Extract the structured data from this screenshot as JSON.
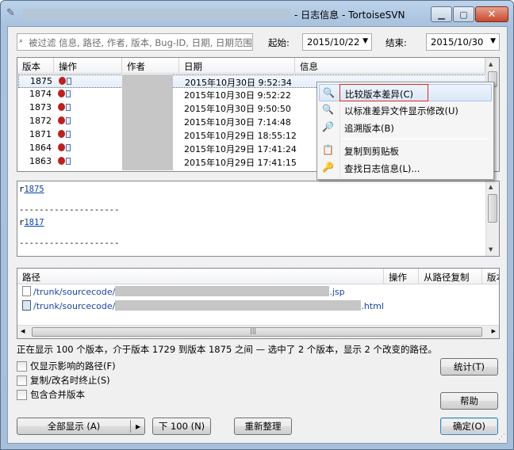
{
  "window": {
    "title": "- 日志信息 - TortoiseSVN",
    "min_icon": "minimize-icon",
    "max_icon": "maximize-icon",
    "close_icon": "close-icon"
  },
  "filter": {
    "placeholder": "被过滤 信息, 路径, 作者, 版本, Bug-ID, 日期, 日期范围"
  },
  "range": {
    "from_label": "起始:",
    "from_value": "2015/10/22",
    "to_label": "结束:",
    "to_value": "2015/10/30"
  },
  "revisions": {
    "columns": [
      "版本",
      "操作",
      "作者",
      "日期",
      "信息"
    ],
    "rows": [
      {
        "rev": "1875",
        "date": "2015年10月30日 9:52:34"
      },
      {
        "rev": "1874",
        "date": "2015年10月30日 9:52:22"
      },
      {
        "rev": "1873",
        "date": "2015年10月30日 9:50:50"
      },
      {
        "rev": "1872",
        "date": "2015年10月30日 7:14:48"
      },
      {
        "rev": "1871",
        "date": "2015年10月29日 18:55:12"
      },
      {
        "rev": "1864",
        "date": "2015年10月29日 17:41:24"
      },
      {
        "rev": "1863",
        "date": "2015年10月29日 17:41:15"
      }
    ]
  },
  "context_menu": {
    "items": [
      {
        "label": "比较版本差异(C)",
        "icon": "compare-magnifier-icon"
      },
      {
        "label": "以标准差异文件显示修改(U)",
        "icon": "diff-magnifier-icon"
      },
      {
        "label": "追溯版本(B)",
        "icon": "blame-icon"
      },
      {
        "label": "复制到剪贴板",
        "icon": "clipboard-icon"
      },
      {
        "label": "查找日志信息(L)...",
        "icon": "find-icon"
      }
    ]
  },
  "message": {
    "line1_prefix": "r",
    "line1_link": "1875",
    "separator": "--------------------",
    "line2_prefix": "r",
    "line2_link": "1817",
    "separator2": "--------------------"
  },
  "paths": {
    "columns": [
      "路径",
      "操作",
      "从路径复制",
      "版本"
    ],
    "rows": [
      {
        "prefix": "/trunk/sourcecode/",
        "suffix": ".jsp"
      },
      {
        "prefix": "/trunk/sourcecode/",
        "suffix": ".html"
      }
    ]
  },
  "status": "正在显示 100 个版本，介于版本 1729 到版本 1875 之间 — 选中了 2 个版本，显示 2 个改变的路径。",
  "options": {
    "affected_only": "仅显示影响的路径(F)",
    "stop_on_copy": "复制/改名时终止(S)",
    "include_merged": "包含合并版本"
  },
  "buttons": {
    "statistics": "统计(T)",
    "help": "帮助",
    "show_all": "全部显示 (A)",
    "show_all_arrow": "▶",
    "next_100": "下 100 (N)",
    "refresh": "重新整理",
    "ok": "确定(O)"
  }
}
